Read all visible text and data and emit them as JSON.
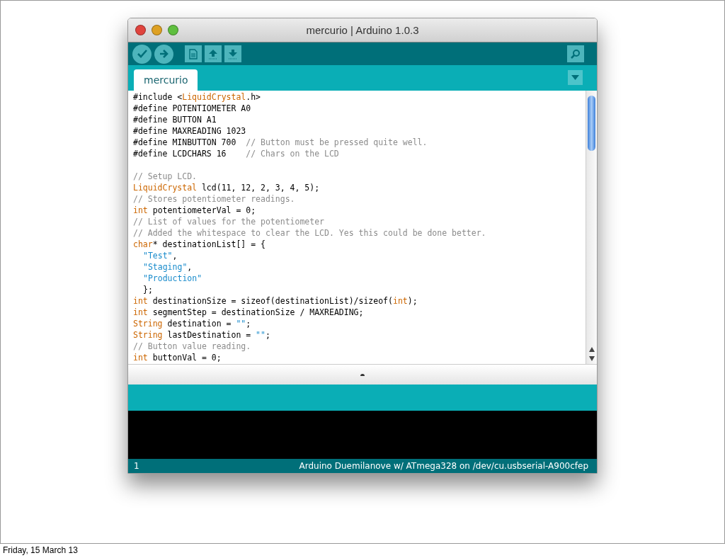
{
  "window": {
    "title": "mercurio | Arduino 1.0.3"
  },
  "toolbar": {
    "buttons": [
      {
        "kind": "verify"
      },
      {
        "kind": "upload"
      },
      {
        "kind": "new"
      },
      {
        "kind": "open"
      },
      {
        "kind": "save"
      }
    ],
    "right_button": {
      "kind": "serial-monitor"
    }
  },
  "tabs": [
    {
      "label": "mercurio",
      "selected": true
    }
  ],
  "editor": {
    "lines": [
      {
        "kind": "code",
        "segments": [
          {
            "kind": "plain",
            "text": "#include <"
          },
          {
            "kind": "keyword",
            "text": "LiquidCrystal"
          },
          {
            "kind": "plain",
            "text": ".h>"
          }
        ]
      },
      {
        "kind": "code",
        "segments": [
          {
            "kind": "plain",
            "text": "#define POTENTIOMETER A0"
          }
        ]
      },
      {
        "kind": "code",
        "segments": [
          {
            "kind": "plain",
            "text": "#define BUTTON A1"
          }
        ]
      },
      {
        "kind": "code",
        "segments": [
          {
            "kind": "plain",
            "text": "#define MAXREADING 1023"
          }
        ]
      },
      {
        "kind": "code",
        "segments": [
          {
            "kind": "plain",
            "text": "#define MINBUTTON 700  "
          },
          {
            "kind": "comment",
            "text": "// Button must be pressed quite well."
          }
        ]
      },
      {
        "kind": "code",
        "segments": [
          {
            "kind": "plain",
            "text": "#define LCDCHARS 16    "
          },
          {
            "kind": "comment",
            "text": "// Chars on the LCD"
          }
        ]
      },
      {
        "kind": "blank"
      },
      {
        "kind": "code",
        "segments": [
          {
            "kind": "comment",
            "text": "// Setup LCD."
          }
        ]
      },
      {
        "kind": "code",
        "segments": [
          {
            "kind": "keyword",
            "text": "LiquidCrystal"
          },
          {
            "kind": "plain",
            "text": " lcd(11, 12, 2, 3, 4, 5);"
          }
        ]
      },
      {
        "kind": "code",
        "segments": [
          {
            "kind": "comment",
            "text": "// Stores potentiometer readings."
          }
        ]
      },
      {
        "kind": "code",
        "segments": [
          {
            "kind": "keyword",
            "text": "int"
          },
          {
            "kind": "plain",
            "text": " potentiometerVal = 0;"
          }
        ]
      },
      {
        "kind": "code",
        "segments": [
          {
            "kind": "comment",
            "text": "// List of values for the potentiometer"
          }
        ]
      },
      {
        "kind": "code",
        "segments": [
          {
            "kind": "comment",
            "text": "// Added the whitespace to clear the LCD. Yes this could be done better."
          }
        ]
      },
      {
        "kind": "code",
        "segments": [
          {
            "kind": "keyword",
            "text": "char"
          },
          {
            "kind": "plain",
            "text": "* destinationList[] = {"
          }
        ]
      },
      {
        "kind": "indented",
        "segments": [
          {
            "kind": "string",
            "text": "\"Test\""
          },
          {
            "kind": "plain",
            "text": ","
          }
        ]
      },
      {
        "kind": "indented",
        "segments": [
          {
            "kind": "string",
            "text": "\"Staging\""
          },
          {
            "kind": "plain",
            "text": ","
          }
        ]
      },
      {
        "kind": "indented",
        "segments": [
          {
            "kind": "string",
            "text": "\"Production\""
          }
        ]
      },
      {
        "kind": "indented",
        "segments": [
          {
            "kind": "plain",
            "text": "};"
          }
        ]
      },
      {
        "kind": "code",
        "segments": [
          {
            "kind": "keyword",
            "text": "int"
          },
          {
            "kind": "plain",
            "text": " destinationSize = sizeof(destinationList)/sizeof("
          },
          {
            "kind": "keyword",
            "text": "int"
          },
          {
            "kind": "plain",
            "text": ");"
          }
        ]
      },
      {
        "kind": "code",
        "segments": [
          {
            "kind": "keyword",
            "text": "int"
          },
          {
            "kind": "plain",
            "text": " segmentStep = destinationSize / MAXREADING;"
          }
        ]
      },
      {
        "kind": "code",
        "segments": [
          {
            "kind": "keyword",
            "text": "String"
          },
          {
            "kind": "plain",
            "text": " destination = "
          },
          {
            "kind": "string",
            "text": "\"\""
          },
          {
            "kind": "plain",
            "text": ";"
          }
        ]
      },
      {
        "kind": "code",
        "segments": [
          {
            "kind": "keyword",
            "text": "String"
          },
          {
            "kind": "plain",
            "text": " lastDestination = "
          },
          {
            "kind": "string",
            "text": "\"\""
          },
          {
            "kind": "plain",
            "text": ";"
          }
        ]
      },
      {
        "kind": "code",
        "segments": [
          {
            "kind": "comment",
            "text": "// Button value reading."
          }
        ]
      },
      {
        "kind": "code",
        "segments": [
          {
            "kind": "keyword",
            "text": "int"
          },
          {
            "kind": "plain",
            "text": " buttonVal = 0;"
          }
        ]
      }
    ]
  },
  "status_bar": {
    "line": "1",
    "board": "Arduino Duemilanove w/ ATmega328 on /dev/cu.usbserial-A900cfep"
  },
  "slide_footer": "Friday, 15 March 13"
}
